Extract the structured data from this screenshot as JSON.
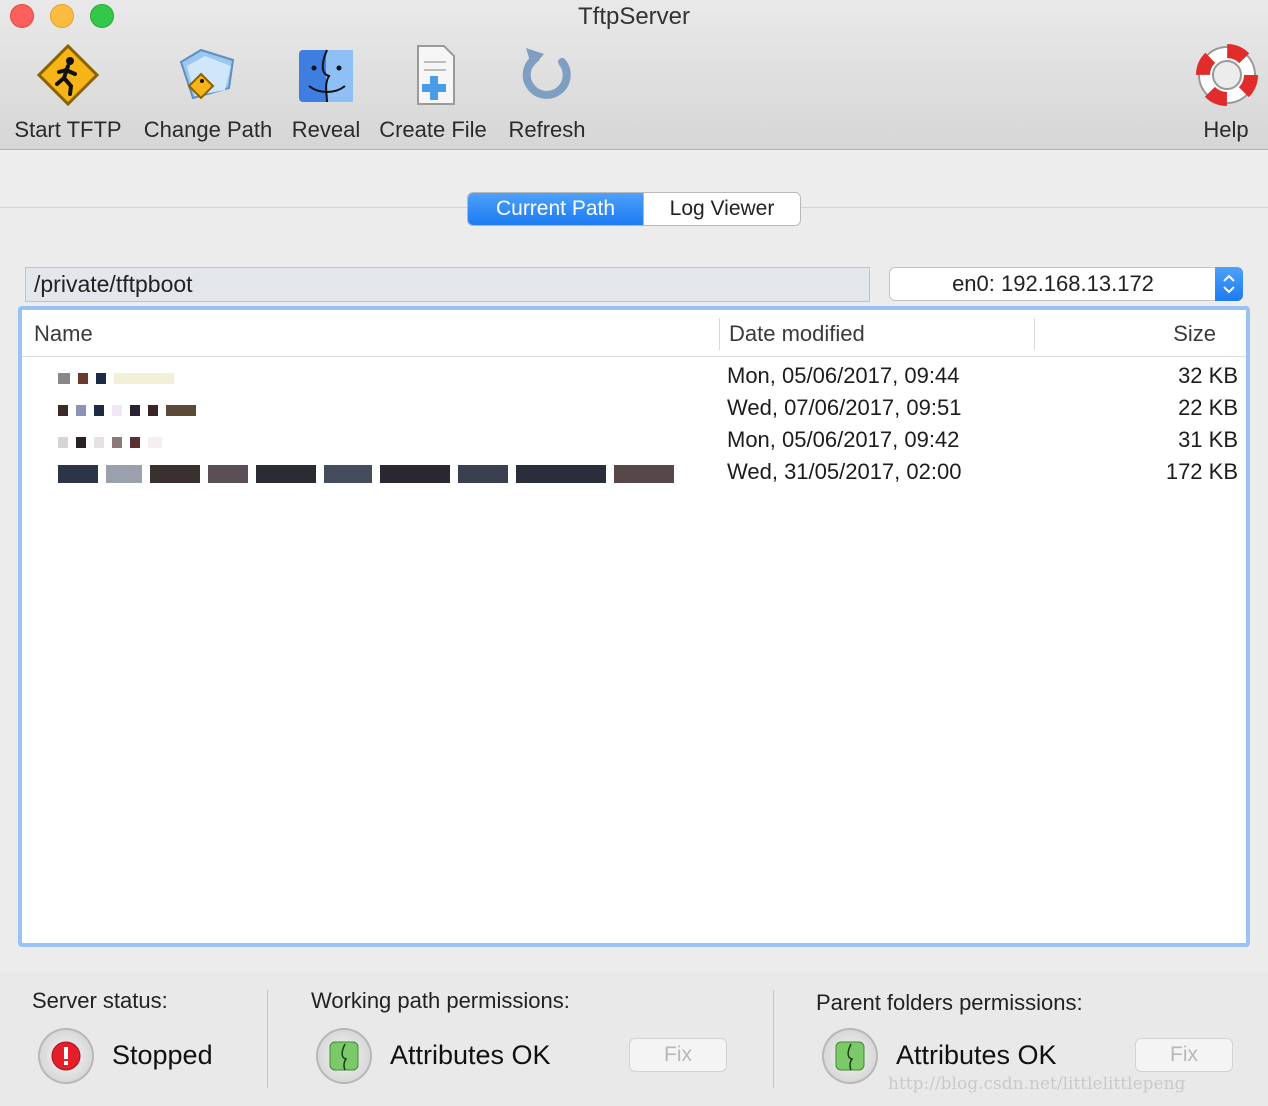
{
  "window": {
    "title": "TftpServer"
  },
  "toolbar": {
    "start": "Start TFTP",
    "change_path": "Change Path",
    "reveal": "Reveal",
    "create_file": "Create File",
    "refresh": "Refresh",
    "help": "Help"
  },
  "tabs": {
    "current_path": "Current Path",
    "log_viewer": "Log Viewer"
  },
  "path": {
    "value": "/private/tftpboot"
  },
  "interface": {
    "selected": "en0: 192.168.13.172"
  },
  "table": {
    "columns": {
      "name": "Name",
      "date": "Date modified",
      "size": "Size"
    },
    "rows": [
      {
        "date": "Mon, 05/06/2017, 09:44",
        "size": "32 KB"
      },
      {
        "date": "Wed, 07/06/2017, 09:51",
        "size": "22 KB"
      },
      {
        "date": "Mon, 05/06/2017, 09:42",
        "size": "31 KB"
      },
      {
        "date": "Wed, 31/05/2017, 02:00",
        "size": "172 KB"
      }
    ]
  },
  "status": {
    "server_label": "Server status:",
    "server_value": "Stopped",
    "working_label": "Working path permissions:",
    "working_value": "Attributes OK",
    "working_fix": "Fix",
    "parent_label": "Parent folders permissions:",
    "parent_value": "Attributes OK",
    "parent_fix": "Fix"
  },
  "watermark": "http://blog.csdn.net/littlelittlepeng",
  "colors": {
    "accent": "#1b7bf2",
    "table_border": "#98c3f2"
  }
}
